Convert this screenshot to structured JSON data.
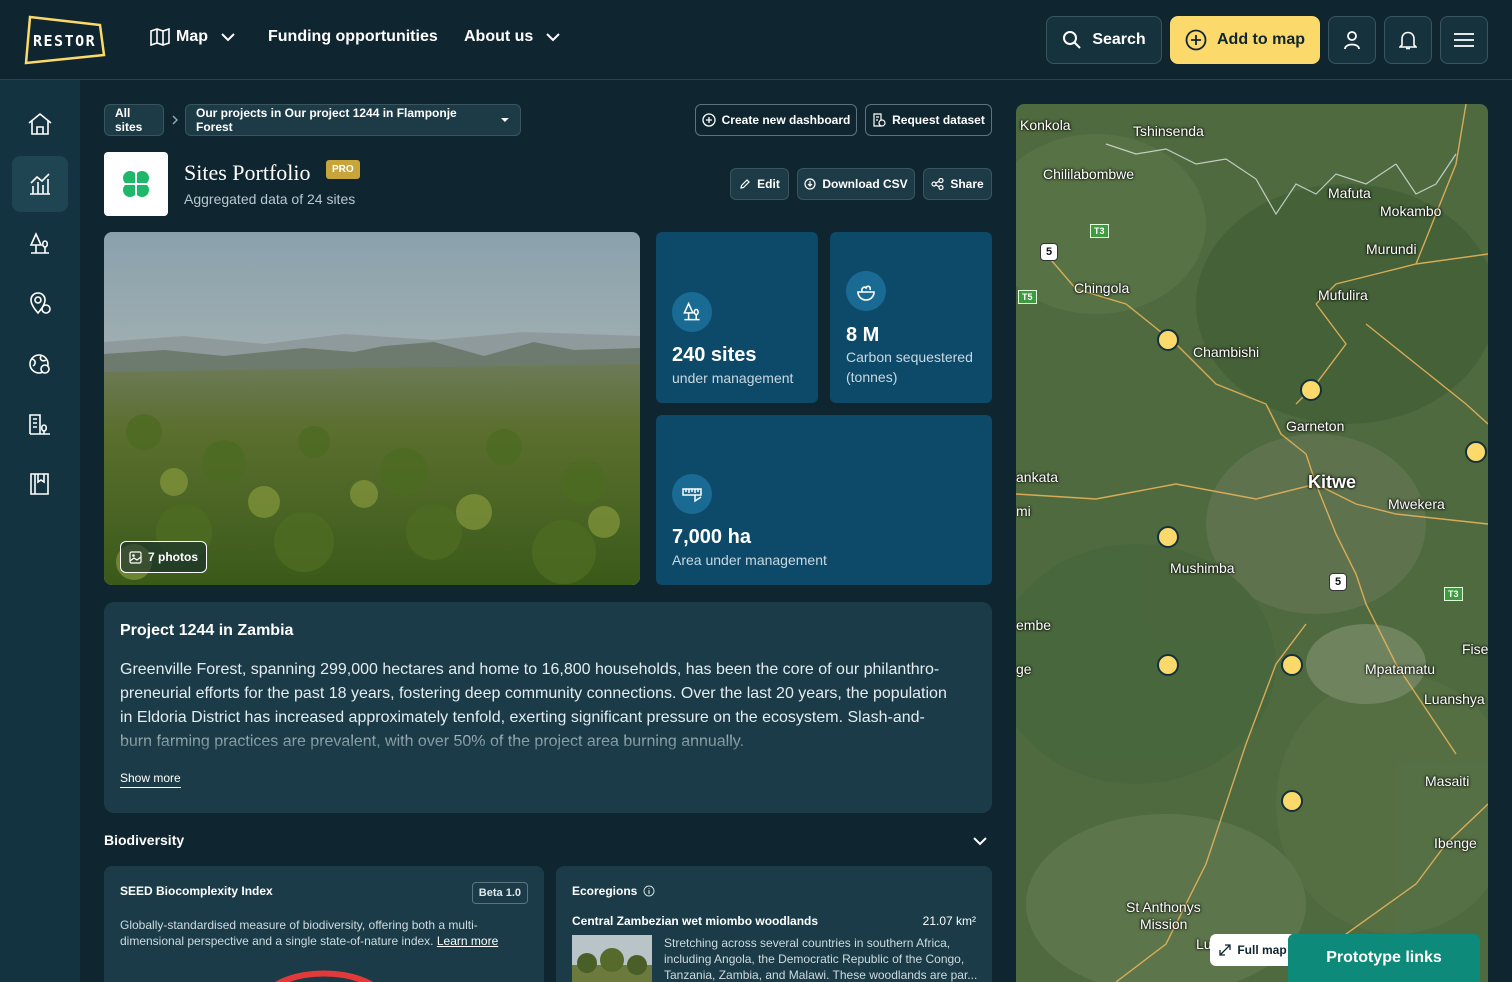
{
  "header": {
    "logo_text": "RESTOR",
    "nav": [
      {
        "label": "Map"
      },
      {
        "label": "Funding opportunities"
      },
      {
        "label": "About us"
      }
    ],
    "search_label": "Search",
    "add_label": "Add to map"
  },
  "breadcrumb": {
    "root": "All sites",
    "current": "Our projects in Our project 1244 in Flamponje Forest"
  },
  "toolbar": {
    "create_dashboard": "Create new dashboard",
    "request_dataset": "Request dataset",
    "edit": "Edit",
    "download": "Download CSV",
    "share": "Share"
  },
  "portfolio": {
    "title": "Sites Portfolio",
    "badge": "PRO",
    "subtitle": "Aggregated data of 24 sites",
    "photos": "7 photos"
  },
  "stats": [
    {
      "value": "240 sites",
      "label": "under management"
    },
    {
      "value": "8 M",
      "label": "Carbon sequestered (tonnes)"
    },
    {
      "value": "7,000 ha",
      "label": "Area under management"
    }
  ],
  "project": {
    "title": "Project 1244 in Zambia",
    "description": "Greenville Forest, spanning 299,000 hectares and home to 16,800 households, has been the core of our philanthro-preneurial efforts for the past 18 years, fostering deep community connections. Over the last 20 years, the population in Eldoria District has increased approximately tenfold, exerting significant pressure on the ecosystem. Slash-and-burn farming practices are prevalent, with over 50% of the project area burning annually.",
    "show_more": "Show more"
  },
  "biodiversity": {
    "title": "Biodiversity",
    "seed": {
      "title": "SEED Biocomplexity Index",
      "badge": "Beta 1.0",
      "text": "Globally-standardised measure of biodiversity, offering both a multi-dimensional perspective and a single state-of-nature index.",
      "link": "Learn more"
    },
    "ecoregions": {
      "title": "Ecoregions",
      "name": "Central Zambezian wet miombo woodlands",
      "area": "21.07 km²",
      "text": "Stretching across several countries in southern Africa, including Angola, the Democratic Republic of the Congo, Tanzania, Zambia, and Malawi. These woodlands are par..."
    }
  },
  "map": {
    "labels": [
      "Konkola",
      "Tshinsenda",
      "Chililabombwe",
      "Mafuta",
      "Mokambo",
      "Murundi",
      "Chingola",
      "Mufulira",
      "Chambishi",
      "Garneton",
      "Kitwe",
      "Mwekera",
      "ankata",
      "mi",
      "Mushimba",
      "embe",
      "ge",
      "Mpatamatu",
      "Fise",
      "Luanshya",
      "Masaiti",
      "Ibenge",
      "St Anthonys",
      "Mission",
      "Lu"
    ],
    "shields": [
      "5",
      "5"
    ],
    "green_shields": [
      "T3",
      "T5",
      "T3"
    ],
    "full_map": "Full map",
    "prototype": "Prototype links"
  }
}
